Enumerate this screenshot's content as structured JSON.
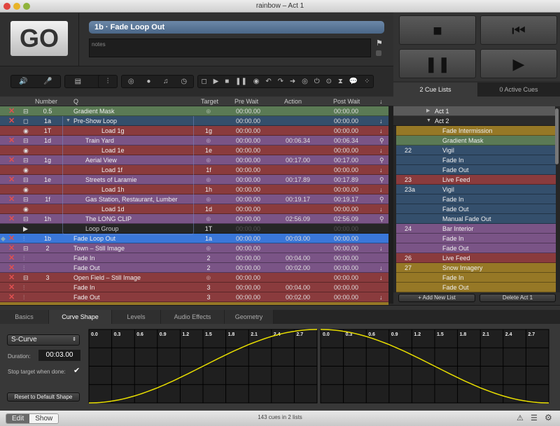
{
  "window": {
    "title": "rainbow – Act 1"
  },
  "go": {
    "label": "GO"
  },
  "current_cue": "1b · Fade Loop Out",
  "notes": {
    "placeholder": "notes"
  },
  "toolbar_groups": [
    {
      "icons": [
        "speaker-icon",
        "microphone-icon"
      ],
      "glyphs": [
        "🔊",
        "🎤"
      ]
    },
    {
      "icons": [
        "film-icon",
        "camera-icon"
      ],
      "glyphs": [
        "▤",
        "■"
      ]
    },
    {
      "icons": [
        "fader-icon"
      ],
      "glyphs": [
        "⫶"
      ]
    },
    {
      "icons": [
        "target-icon",
        "midi-icon",
        "music-icon",
        "clock-icon"
      ],
      "glyphs": [
        "◎",
        "●",
        "♫",
        "◷"
      ]
    },
    {
      "icons": [
        "group-icon",
        "start-icon",
        "stop-icon",
        "pause-icon",
        "load-icon",
        "reset-icon",
        "redo-icon",
        "goto-icon",
        "target-arrow-icon",
        "power-icon",
        "script-icon",
        "wait-icon",
        "memo-icon",
        "more-icon"
      ],
      "glyphs": [
        "◻",
        "▶",
        "■",
        "❚❚",
        "◉",
        "↶",
        "↷",
        "➜",
        "◎",
        "⏻",
        "⊙",
        "⧗",
        "💬",
        "⁘"
      ]
    }
  ],
  "transport": [
    {
      "icon": "stop-icon",
      "glyph": "■"
    },
    {
      "icon": "rewind-icon",
      "glyph": "⏮"
    },
    {
      "icon": "pause-icon",
      "glyph": "❚❚"
    },
    {
      "icon": "play-icon",
      "glyph": "▶"
    }
  ],
  "right_tabs": [
    "2 Cue Lists",
    "0 Active Cues"
  ],
  "table": {
    "headers": {
      "number": "Number",
      "q": "Q",
      "target": "Target",
      "pre": "Pre Wait",
      "action": "Action",
      "post": "Post Wait"
    },
    "colors": {
      "green": "#5b7a55",
      "blue": "#344f6c",
      "red": "#8a3b3d",
      "purple": "#7a5486",
      "dark": "#262626",
      "selected": "#3a77d9",
      "gold": "#967826"
    },
    "rows": [
      {
        "x": true,
        "icon": "video",
        "num": "0.5",
        "name": "Gradient Mask",
        "ind": 0,
        "target": "",
        "tgt_icon": true,
        "pre": "00:00.00",
        "action": "",
        "post": "00:00.00",
        "arrow": "",
        "color": "green"
      },
      {
        "x": true,
        "icon": "group",
        "num": "1a",
        "name": "Pre-Show Loop",
        "ind": 0,
        "tri": true,
        "target": "",
        "pre": "00:00.00",
        "action": "",
        "post": "00:00.00",
        "arrow": "↓",
        "color": "blue"
      },
      {
        "x": false,
        "icon": "load",
        "num": "1T",
        "name": "Load 1g",
        "ind": 2,
        "target": "1g",
        "pre": "00:00.00",
        "action": "",
        "post": "00:00.00",
        "arrow": "↓",
        "color": "red"
      },
      {
        "x": true,
        "icon": "video",
        "num": "1d",
        "name": "Train Yard",
        "ind": 1,
        "target": "",
        "tgt_icon": true,
        "pre": "00:00.00",
        "action": "00:06.34",
        "post": "00:06.34",
        "arrow": "⚲",
        "color": "purple"
      },
      {
        "x": false,
        "icon": "load",
        "num": "",
        "name": "Load 1e",
        "ind": 2,
        "target": "1e",
        "pre": "00:00.00",
        "action": "",
        "post": "00:00.00",
        "arrow": "↓",
        "color": "red"
      },
      {
        "x": true,
        "icon": "video",
        "num": "1g",
        "name": "Aerial View",
        "ind": 1,
        "target": "",
        "tgt_icon": true,
        "pre": "00:00.00",
        "action": "00:17.00",
        "post": "00:17.00",
        "arrow": "⚲",
        "color": "purple"
      },
      {
        "x": false,
        "icon": "load",
        "num": "",
        "name": "Load 1f",
        "ind": 2,
        "target": "1f",
        "pre": "00:00.00",
        "action": "",
        "post": "00:00.00",
        "arrow": "↓",
        "color": "red"
      },
      {
        "x": true,
        "icon": "video",
        "num": "1e",
        "name": "Streets of Laramie",
        "ind": 1,
        "target": "",
        "tgt_icon": true,
        "pre": "00:00.00",
        "action": "00:17.89",
        "post": "00:17.89",
        "arrow": "⚲",
        "color": "purple"
      },
      {
        "x": false,
        "icon": "load",
        "num": "",
        "name": "Load 1h",
        "ind": 2,
        "target": "1h",
        "pre": "00:00.00",
        "action": "",
        "post": "00:00.00",
        "arrow": "↓",
        "color": "red"
      },
      {
        "x": true,
        "icon": "video",
        "num": "1f",
        "name": "Gas Station, Restaurant, Lumber",
        "ind": 1,
        "target": "",
        "tgt_icon": true,
        "pre": "00:00.00",
        "action": "00:19.17",
        "post": "00:19.17",
        "arrow": "⚲",
        "color": "purple"
      },
      {
        "x": false,
        "icon": "load",
        "num": "",
        "name": "Load 1d",
        "ind": 2,
        "target": "1d",
        "pre": "00:00.00",
        "action": "",
        "post": "00:00.00",
        "arrow": "↓",
        "color": "red"
      },
      {
        "x": true,
        "icon": "video",
        "num": "1h",
        "name": "The LONG CLIP",
        "ind": 1,
        "target": "",
        "tgt_icon": true,
        "pre": "00:00.00",
        "action": "02:56.09",
        "post": "02:56.09",
        "arrow": "⚲",
        "color": "purple"
      },
      {
        "x": false,
        "icon": "start",
        "num": "",
        "name": "Loop Group",
        "ind": 1,
        "target": "1T",
        "pre": "00:00.00",
        "action": "",
        "post": "00:00.00",
        "arrow": "",
        "color": "dark",
        "dim": true
      },
      {
        "x": true,
        "icon": "fade",
        "num": "1b",
        "name": "Fade Loop Out",
        "ind": 0,
        "target": "1a",
        "pre": "00:00.00",
        "action": "00:03.00",
        "post": "00:00.00",
        "arrow": "",
        "color": "selected",
        "playhead": true
      },
      {
        "x": true,
        "icon": "video",
        "num": "2",
        "name": "Town – Still Image",
        "ind": 0,
        "target": "",
        "tgt_icon": true,
        "pre": "00:00.00",
        "action": "",
        "post": "00:00.00",
        "arrow": "↓",
        "color": "purple"
      },
      {
        "x": true,
        "icon": "fade",
        "num": "",
        "name": "Fade In",
        "ind": 0,
        "target": "2",
        "pre": "00:00.00",
        "action": "00:04.00",
        "post": "00:00.00",
        "arrow": "",
        "color": "purple"
      },
      {
        "x": true,
        "icon": "fade",
        "num": "",
        "name": "Fade Out",
        "ind": 0,
        "target": "2",
        "pre": "00:00.00",
        "action": "00:02.00",
        "post": "00:00.00",
        "arrow": "↓",
        "color": "purple"
      },
      {
        "x": true,
        "icon": "video",
        "num": "3",
        "name": "Open Field – Still Image",
        "ind": 0,
        "target": "",
        "tgt_icon": true,
        "pre": "00:00.00",
        "action": "",
        "post": "00:00.00",
        "arrow": "↓",
        "color": "red"
      },
      {
        "x": true,
        "icon": "fade",
        "num": "",
        "name": "Fade In",
        "ind": 0,
        "target": "3",
        "pre": "00:00.00",
        "action": "00:04.00",
        "post": "00:00.00",
        "arrow": "",
        "color": "red"
      },
      {
        "x": true,
        "icon": "fade",
        "num": "",
        "name": "Fade Out",
        "ind": 0,
        "target": "3",
        "pre": "00:00.00",
        "action": "00:02.00",
        "post": "00:00.00",
        "arrow": "↓",
        "color": "red"
      }
    ]
  },
  "cue_lists": {
    "items": [
      {
        "num": "",
        "name": "Act 1",
        "type": "list",
        "open": false,
        "color": "#5a5a5a"
      },
      {
        "num": "",
        "name": "Act 2",
        "type": "list",
        "open": true,
        "color": "#2b2b2b"
      },
      {
        "num": "",
        "name": "Fade Intermission",
        "color": "#967826"
      },
      {
        "num": "",
        "name": "Gradient Mask",
        "color": "#5b7a55"
      },
      {
        "num": "22",
        "name": "Vigil",
        "color": "#344f6c"
      },
      {
        "num": "",
        "name": "Fade In",
        "color": "#344f6c"
      },
      {
        "num": "",
        "name": "Fade Out",
        "color": "#344f6c"
      },
      {
        "num": "23",
        "name": "Live Feed",
        "color": "#8a3b3d"
      },
      {
        "num": "23a",
        "name": "Vigil",
        "color": "#344f6c"
      },
      {
        "num": "",
        "name": "Fade In",
        "color": "#344f6c"
      },
      {
        "num": "",
        "name": "Fade Out",
        "color": "#344f6c"
      },
      {
        "num": "",
        "name": "Manual Fade Out",
        "color": "#344f6c"
      },
      {
        "num": "24",
        "name": "Bar Interior",
        "color": "#7a5486"
      },
      {
        "num": "",
        "name": "Fade In",
        "color": "#7a5486"
      },
      {
        "num": "",
        "name": "Fade Out",
        "color": "#7a5486"
      },
      {
        "num": "26",
        "name": "Live Feed",
        "color": "#8a3b3d"
      },
      {
        "num": "27",
        "name": "Snow Imagery",
        "color": "#967826"
      },
      {
        "num": "",
        "name": "Fade In",
        "color": "#967826"
      },
      {
        "num": "",
        "name": "Fade Out",
        "color": "#967826"
      }
    ],
    "add_button": "+ Add New List",
    "delete_button": "Delete Act 1"
  },
  "inspector": {
    "tabs": [
      "Basics",
      "Curve Shape",
      "Levels",
      "Audio Effects",
      "Geometry"
    ],
    "active_tab": "Curve Shape",
    "curve_type": "S-Curve",
    "duration_label": "Duration:",
    "duration": "00:03.00",
    "stop_target_label": "Stop target when done:",
    "stop_target_checked": true,
    "reset_button": "Reset to Default Shape",
    "time_ticks": [
      "0.0",
      "0.3",
      "0.6",
      "0.9",
      "1.2",
      "1.5",
      "1.8",
      "2.1",
      "2.4",
      "2.7"
    ],
    "curve_color": "#e8de00"
  },
  "status": {
    "modes": [
      "Edit",
      "Show"
    ],
    "active_mode": "Edit",
    "summary": "143 cues in 2 lists",
    "icons": [
      "warning-icon",
      "list-icon",
      "gear-icon"
    ]
  }
}
